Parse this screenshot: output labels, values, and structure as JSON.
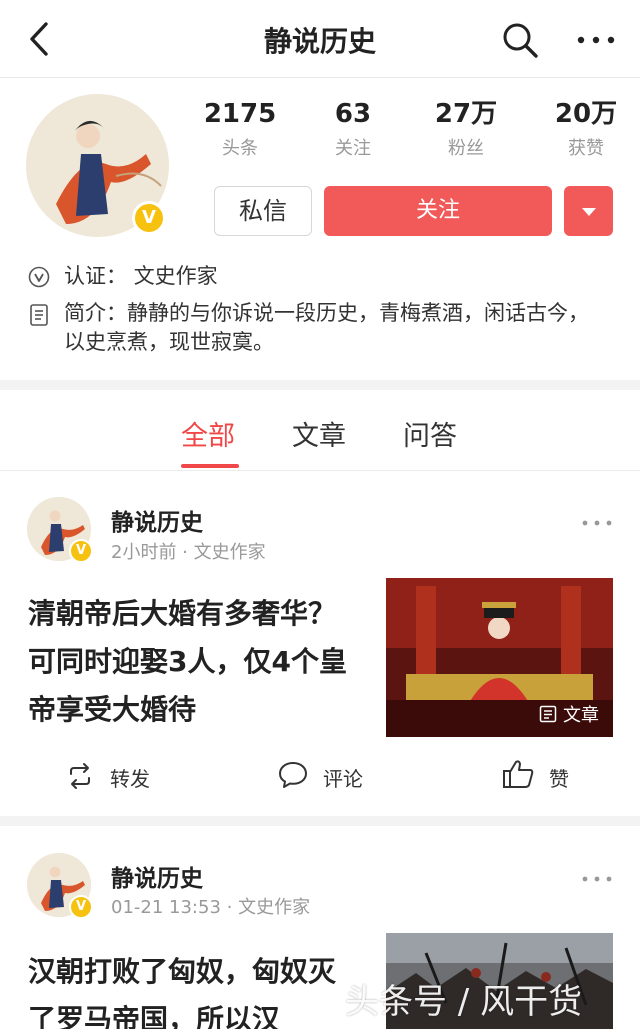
{
  "nav": {
    "title": "静说历史"
  },
  "profile": {
    "stats": [
      {
        "value": "2175",
        "label": "头条"
      },
      {
        "value": "63",
        "label": "关注"
      },
      {
        "value": "27万",
        "label": "粉丝"
      },
      {
        "value": "20万",
        "label": "获赞"
      }
    ],
    "message_label": "私信",
    "follow_label": "关注",
    "verify_label": "认证：",
    "verify_value": "文史作家",
    "bio_label": "简介：",
    "bio_text": "静静的与你诉说一段历史，青梅煮酒，闲话古今，以史烹煮，现世寂寞。"
  },
  "tabs": [
    {
      "label": "全部",
      "active": true
    },
    {
      "label": "文章",
      "active": false
    },
    {
      "label": "问答",
      "active": false
    }
  ],
  "feed": [
    {
      "author": "静说历史",
      "meta": "2小时前 · 文史作家",
      "headline": "清朝帝后大婚有多奢华？可同时迎娶3人，仅4个皇帝享受大婚待",
      "thumb_tag": "文章",
      "actions": {
        "repost": "转发",
        "comment": "评论",
        "like": "赞"
      }
    },
    {
      "author": "静说历史",
      "meta": "01-21 13:53 · 文史作家",
      "headline": "汉朝打败了匈奴，匈奴灭了罗马帝国，所以汉"
    }
  ],
  "watermark": "头条号 / 风干货",
  "colors": {
    "accent": "#f25a5a",
    "badge": "#f6c20f",
    "muted": "#999999"
  }
}
